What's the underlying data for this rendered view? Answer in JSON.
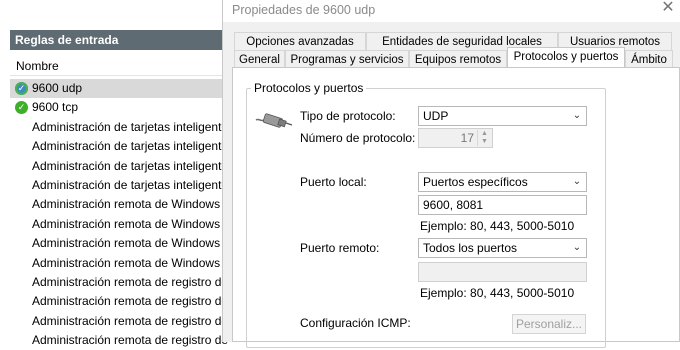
{
  "left_panel": {
    "header": "Reglas de entrada",
    "column": "Nombre",
    "rules": [
      {
        "name": "9600 udp",
        "icon": "check-icon",
        "selected": true
      },
      {
        "name": "9600 tcp",
        "icon": "check-icon",
        "selected": false
      },
      {
        "name": "Administración de tarjetas inteligentes",
        "icon": "",
        "selected": false
      },
      {
        "name": "Administración de tarjetas inteligentes",
        "icon": "",
        "selected": false
      },
      {
        "name": "Administración de tarjetas inteligentes",
        "icon": "",
        "selected": false
      },
      {
        "name": "Administración de tarjetas inteligentes",
        "icon": "",
        "selected": false
      },
      {
        "name": "Administración remota de Windows",
        "icon": "",
        "selected": false
      },
      {
        "name": "Administración remota de Windows",
        "icon": "",
        "selected": false
      },
      {
        "name": "Administración remota de Windows",
        "icon": "",
        "selected": false
      },
      {
        "name": "Administración remota de Windows",
        "icon": "",
        "selected": false
      },
      {
        "name": "Administración remota de registro de",
        "icon": "",
        "selected": false
      },
      {
        "name": "Administración remota de registro de",
        "icon": "",
        "selected": false
      },
      {
        "name": "Administración remota de registro de",
        "icon": "",
        "selected": false
      },
      {
        "name": "Administración remota de registro de",
        "icon": "",
        "selected": false
      }
    ]
  },
  "dialog": {
    "title": "Propiedades de 9600 udp",
    "tabs_row1": [
      "Opciones avanzadas",
      "Entidades de seguridad locales",
      "Usuarios remotos"
    ],
    "tabs_row2": [
      "General",
      "Programas y servicios",
      "Equipos remotos",
      "Protocolos y puertos",
      "Ámbito"
    ],
    "active_tab": "Protocolos y puertos",
    "group_title": "Protocolos y puertos",
    "protocol_type_label": "Tipo de protocolo:",
    "protocol_type_value": "UDP",
    "protocol_number_label": "Número de protocolo:",
    "protocol_number_value": "17",
    "local_port_label": "Puerto local:",
    "local_port_mode": "Puertos específicos",
    "local_port_value": "9600, 8081",
    "local_port_hint": "Ejemplo: 80, 443, 5000-5010",
    "remote_port_label": "Puerto remoto:",
    "remote_port_mode": "Todos los puertos",
    "remote_port_value": "",
    "remote_port_hint": "Ejemplo: 80, 443, 5000-5010",
    "icmp_label": "Configuración ICMP:",
    "icmp_button": "Personaliz..."
  }
}
